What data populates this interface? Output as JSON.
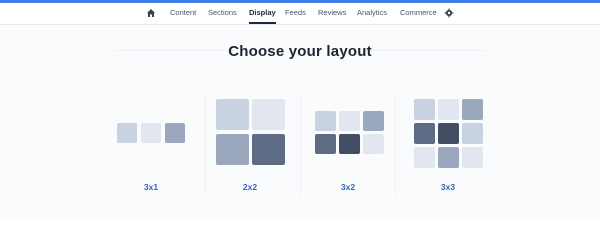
{
  "nav": {
    "items": [
      {
        "label": "Content"
      },
      {
        "label": "Sections"
      },
      {
        "label": "Display"
      },
      {
        "label": "Feeds"
      },
      {
        "label": "Reviews"
      },
      {
        "label": "Analytics"
      },
      {
        "label": "Commerce"
      }
    ],
    "active_index": 2,
    "icons": [
      "home-icon",
      "gear-icon"
    ]
  },
  "main": {
    "title": "Choose your layout",
    "options": [
      {
        "label": "3x1"
      },
      {
        "label": "2x2"
      },
      {
        "label": "3x2"
      },
      {
        "label": "3x3"
      }
    ]
  },
  "colors": {
    "accent": "#3f7ee6",
    "label_blue": "#3267b5",
    "tile_light": "#e2e6ef",
    "tile_mid": "#c9d2e0",
    "tile_gray": "#9aa7bd",
    "tile_dark": "#5e6b84",
    "tile_darkest": "#434d63"
  }
}
